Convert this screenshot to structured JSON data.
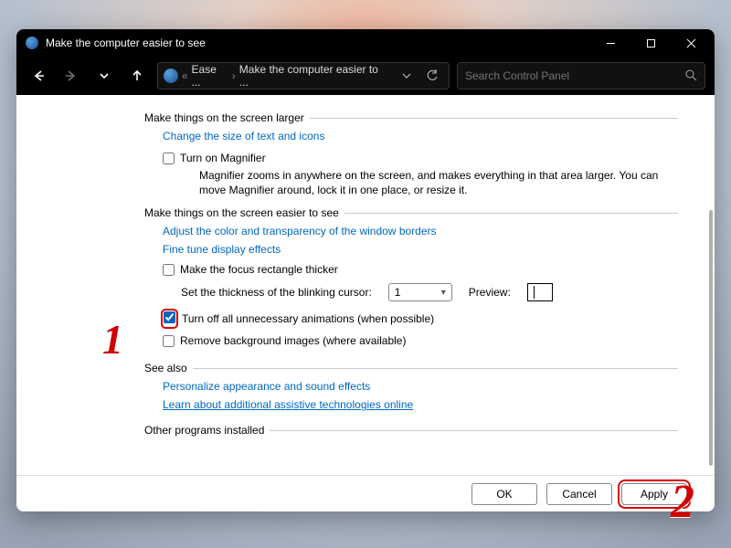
{
  "window": {
    "title": "Make the computer easier to see"
  },
  "titlebar_buttons": {
    "minimize": "minimize",
    "maximize": "maximize",
    "close": "close"
  },
  "nav": {
    "back": "back",
    "forward": "forward",
    "recent": "recent",
    "up": "up"
  },
  "address": {
    "crumb1": "Ease ...",
    "crumb2": "Make the computer easier to ..."
  },
  "search": {
    "placeholder": "Search Control Panel"
  },
  "sections": {
    "larger": {
      "title": "Make things on the screen larger",
      "link_size": "Change the size of text and icons",
      "chk_magnifier": "Turn on Magnifier",
      "magnifier_desc": "Magnifier zooms in anywhere on the screen, and makes everything in that area larger. You can move Magnifier around, lock it in one place, or resize it."
    },
    "easier": {
      "title": "Make things on the screen easier to see",
      "link_borders": "Adjust the color and transparency of the window borders",
      "link_finetune": "Fine tune display effects",
      "chk_focus": "Make the focus rectangle thicker",
      "cursor_label": "Set the thickness of the blinking cursor:",
      "cursor_value": "1",
      "preview_label": "Preview:",
      "chk_anim": "Turn off all unnecessary animations (when possible)",
      "chk_bg": "Remove background images (where available)"
    },
    "seealso": {
      "title": "See also",
      "link_personalize": "Personalize appearance and sound effects",
      "link_learn": "Learn about additional assistive technologies online"
    },
    "other": {
      "title": "Other programs installed"
    }
  },
  "buttons": {
    "ok": "OK",
    "cancel": "Cancel",
    "apply": "Apply"
  },
  "annotations": {
    "one": "1",
    "two": "2"
  }
}
